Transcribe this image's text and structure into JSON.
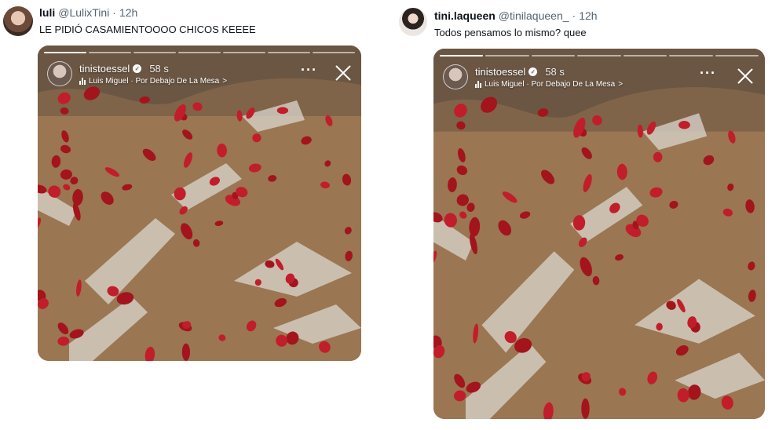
{
  "tweets": [
    {
      "name": "luli",
      "handle": "@LulixTini",
      "separator": "·",
      "time": "12h",
      "text": "LE PIDIÓ CASAMIENTOOOO CHICOS KEEEE",
      "story": {
        "username": "tinistoessel",
        "time": "58 s",
        "music": "Luis Miguel · Por Debajo De La Mesa",
        "chevron": ">",
        "more": "···"
      }
    },
    {
      "name": "tini.laqueen",
      "handle": "@tinilaqueen_",
      "separator": "·",
      "time": "12h",
      "text": "Todos pensamos lo mismo? quee",
      "story": {
        "username": "tinistoessel",
        "time": "58 s",
        "music": "Luis Miguel · Por Debajo De La Mesa",
        "chevron": ">",
        "more": "···"
      }
    }
  ],
  "icons": {
    "verified": "verified-badge-icon",
    "music": "music-bars-icon",
    "more": "more-options-icon",
    "close": "close-icon"
  },
  "colors": {
    "sand": "#9a7652",
    "petal": "#a3141c",
    "text": "#0f1419",
    "muted": "#536471"
  }
}
